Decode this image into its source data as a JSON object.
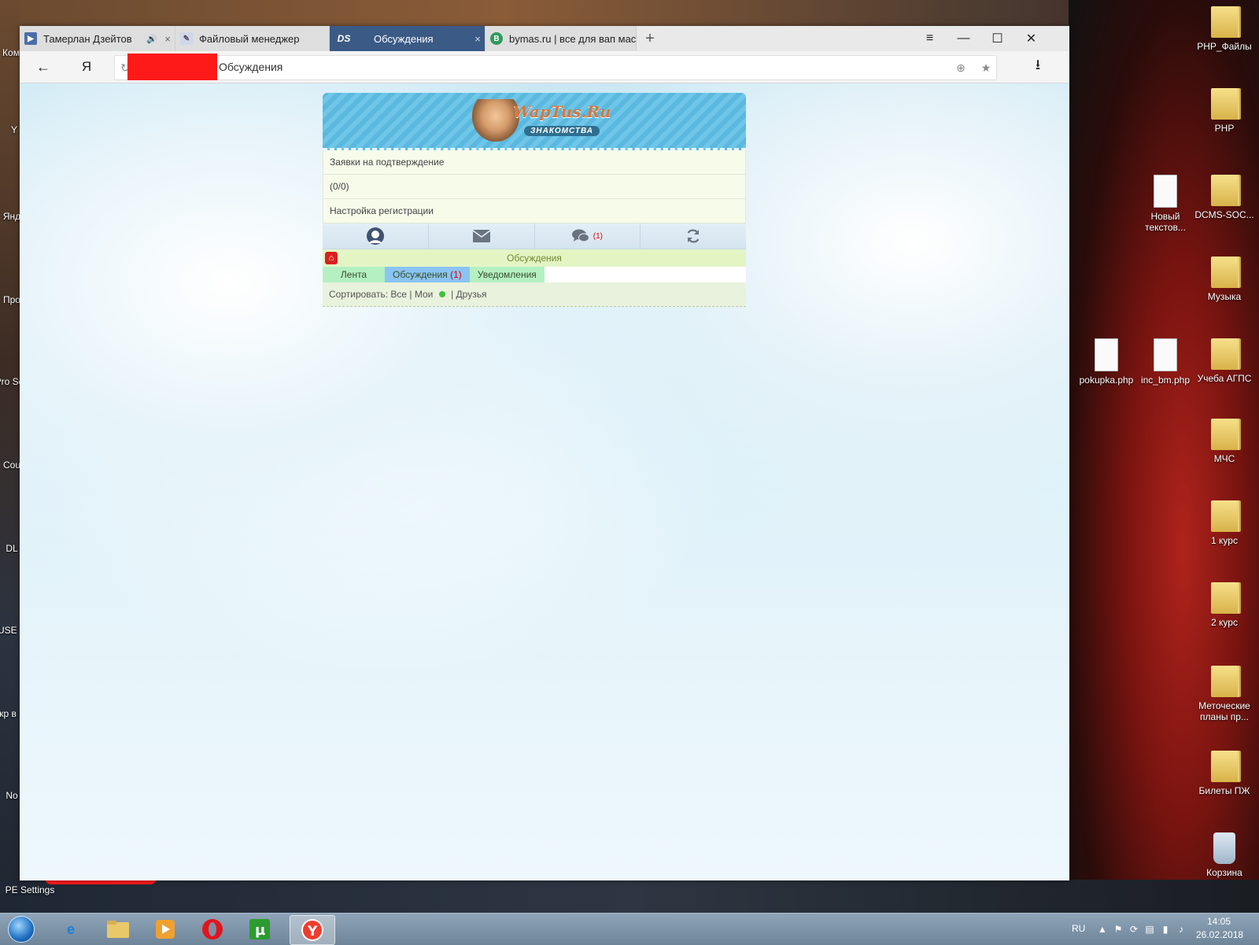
{
  "browser": {
    "tabs": [
      {
        "label": "Тамерлан Дзейтов",
        "favicon": "video-favicon",
        "close": "×",
        "audio": "🔊"
      },
      {
        "label": "Файловый менеджер",
        "favicon": "filemanager-favicon",
        "close": "×"
      },
      {
        "label": "Обсуждения",
        "favicon": "DS",
        "close": "×",
        "active": true
      },
      {
        "label": "bymas.ru | все для вап маст",
        "favicon": "B",
        "close": "×"
      }
    ],
    "new_tab": "+",
    "menu": "≡",
    "minimize": "—",
    "maximize": "☐",
    "close": "✕",
    "back": "←",
    "yandex": "Я",
    "reload": "↻",
    "address_title": "Обсуждения",
    "download": "⭳",
    "bookmark": "★",
    "protect": "⊕"
  },
  "site": {
    "logo_title": "WapTus.Ru",
    "logo_sub": "ЗНАКОМСТВА",
    "rows": [
      "Заявки на подтверждение",
      "(0/0)",
      "Настройка регистрации"
    ],
    "icons": {
      "profile": "profile-icon",
      "mail": "mail-icon",
      "chat": "chat-icon",
      "chat_badge": "(1)",
      "refresh": "refresh-icon"
    },
    "page_title": "Обсуждения",
    "tabs": {
      "feed": "Лента",
      "discussions": "Обсуждения",
      "discussions_count": "(1)",
      "notifications": "Уведомления"
    },
    "sort": {
      "label": "Сортировать:",
      "all": "Все",
      "sep1": "|",
      "mine": "Мои",
      "sep2": "|",
      "friends": "Друзья"
    }
  },
  "desktop": {
    "right_icons": [
      "PHP_Файлы",
      "PHP",
      "Новый текстов...",
      "DCMS-SOC...",
      "Музыка",
      "pokupka.php",
      "inc_bm.php",
      "Учеба АГПС",
      "МЧС",
      "1 курс",
      "2 курс",
      "Меточеские планы пр...",
      "Билеты ПЖ",
      "Корзина"
    ],
    "left_icons": [
      "Ком",
      "Y",
      "Янд",
      "Про",
      "Pro Soc",
      "Cou",
      "DL",
      "USE B",
      "Скр в Ян",
      "No",
      "PE Settings"
    ]
  },
  "taskbar": {
    "lang": "RU",
    "time": "14:05",
    "date": "26.02.2018",
    "apps": [
      "ie",
      "explorer",
      "media",
      "opera",
      "utorrent",
      "yandex"
    ]
  }
}
